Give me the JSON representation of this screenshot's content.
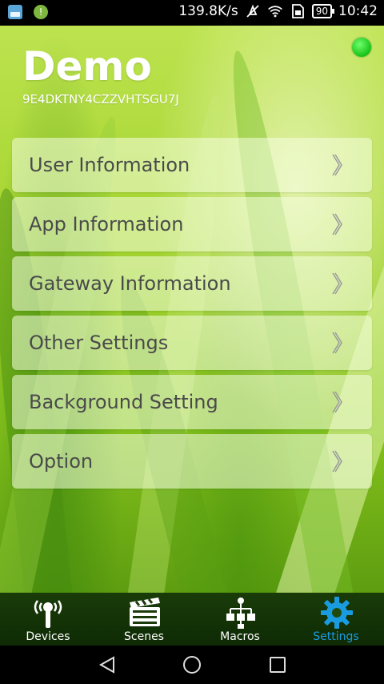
{
  "status_bar": {
    "network_speed": "139.8K/s",
    "battery": "90",
    "time": "10:42"
  },
  "header": {
    "title": "Demo",
    "device_id": "9E4DKTNY4CZZVHTSGU7J",
    "connection_status_color": "#22cc22"
  },
  "menu": {
    "items": [
      {
        "label": "User Information"
      },
      {
        "label": "App Information"
      },
      {
        "label": "Gateway Information"
      },
      {
        "label": "Other Settings"
      },
      {
        "label": "Background Setting"
      },
      {
        "label": "Option"
      }
    ]
  },
  "tabs": [
    {
      "label": "Devices",
      "icon": "devices-icon",
      "active": false
    },
    {
      "label": "Scenes",
      "icon": "clapperboard-icon",
      "active": false
    },
    {
      "label": "Macros",
      "icon": "macros-icon",
      "active": false
    },
    {
      "label": "Settings",
      "icon": "gear-icon",
      "active": true
    }
  ],
  "colors": {
    "active_tab": "#1a9be0",
    "accent": "#22cc22"
  }
}
